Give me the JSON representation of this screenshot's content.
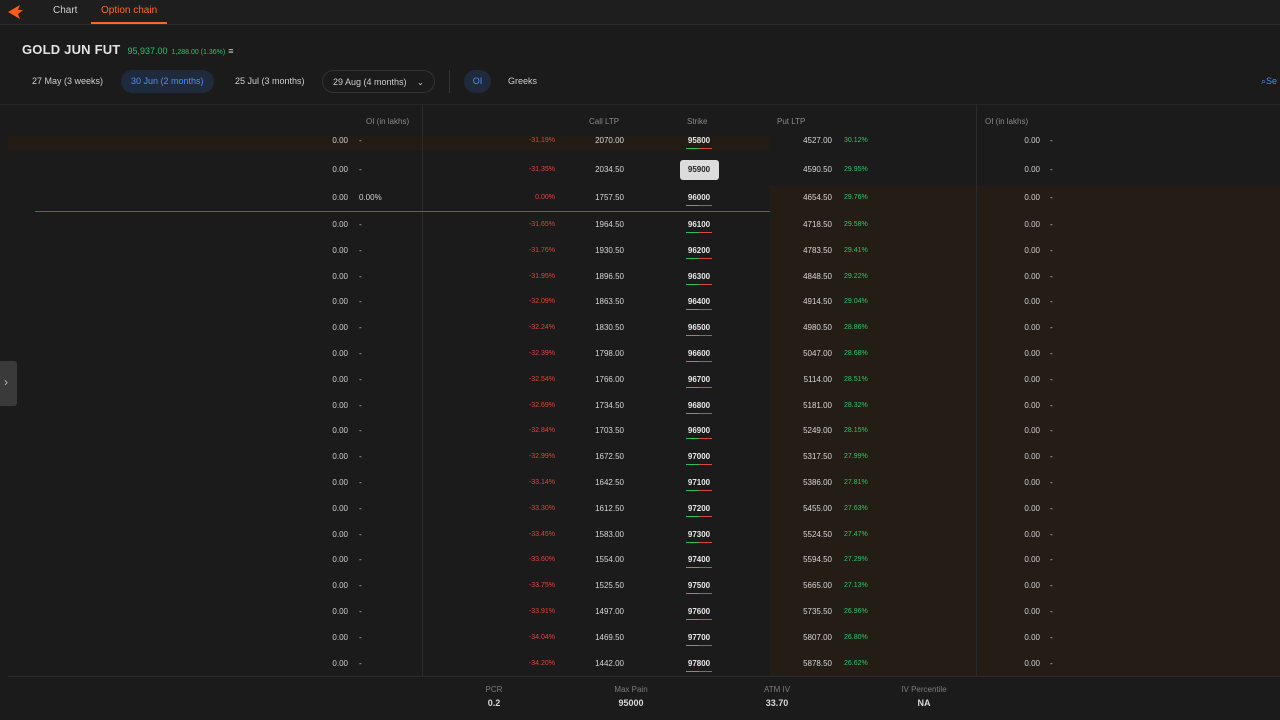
{
  "tabs": [
    {
      "label": "Chart"
    },
    {
      "label": "Option chain"
    }
  ],
  "instrument": {
    "name": "GOLD JUN FUT",
    "price": "95,937.00",
    "change": "1,288.00 (1.36%)",
    "menu_icon": "≡"
  },
  "expiries": [
    {
      "label": "27 May (3 weeks)"
    },
    {
      "label": "30 Jun (2 months)"
    },
    {
      "label": "25 Jul (3 months)"
    },
    {
      "label": "29 Aug (4 months)"
    }
  ],
  "chips": {
    "oi": "OI",
    "greeks": "Greeks"
  },
  "search": {
    "label": "Se"
  },
  "columns": {
    "call_oi": "OI (in lakhs)",
    "call_ltp": "Call LTP",
    "strike": "Strike",
    "put_ltp": "Put LTP",
    "put_oi": "OI (in lakhs)"
  },
  "rows": [
    {
      "call_oi": "0.00",
      "call_oi_ch": "-",
      "call_ch": "-31.19%",
      "call_ltp": "2070.00",
      "strike": "95800",
      "put_ltp": "4527.00",
      "put_ch": "30.12%",
      "put_oi": "0.00",
      "put_oi_ch": "-"
    },
    {
      "call_oi": "0.00",
      "call_oi_ch": "-",
      "call_ch": "-31.35%",
      "call_ltp": "2034.50",
      "strike": "95900",
      "put_ltp": "4590.50",
      "put_ch": "29.95%",
      "put_oi": "0.00",
      "put_oi_ch": "-"
    },
    {
      "call_oi": "0.00",
      "call_oi_ch": "0.00%",
      "call_ch": "0.00%",
      "call_ltp": "1757.50",
      "strike": "96000",
      "put_ltp": "4654.50",
      "put_ch": "29.76%",
      "put_oi": "0.00",
      "put_oi_ch": "-"
    },
    {
      "call_oi": "0.00",
      "call_oi_ch": "-",
      "call_ch": "-31.65%",
      "call_ltp": "1964.50",
      "strike": "96100",
      "put_ltp": "4718.50",
      "put_ch": "29.58%",
      "put_oi": "0.00",
      "put_oi_ch": "-"
    },
    {
      "call_oi": "0.00",
      "call_oi_ch": "-",
      "call_ch": "-31.76%",
      "call_ltp": "1930.50",
      "strike": "96200",
      "put_ltp": "4783.50",
      "put_ch": "29.41%",
      "put_oi": "0.00",
      "put_oi_ch": "-"
    },
    {
      "call_oi": "0.00",
      "call_oi_ch": "-",
      "call_ch": "-31.95%",
      "call_ltp": "1896.50",
      "strike": "96300",
      "put_ltp": "4848.50",
      "put_ch": "29.22%",
      "put_oi": "0.00",
      "put_oi_ch": "-"
    },
    {
      "call_oi": "0.00",
      "call_oi_ch": "-",
      "call_ch": "-32.09%",
      "call_ltp": "1863.50",
      "strike": "96400",
      "put_ltp": "4914.50",
      "put_ch": "29.04%",
      "put_oi": "0.00",
      "put_oi_ch": "-"
    },
    {
      "call_oi": "0.00",
      "call_oi_ch": "-",
      "call_ch": "-32.24%",
      "call_ltp": "1830.50",
      "strike": "96500",
      "put_ltp": "4980.50",
      "put_ch": "28.86%",
      "put_oi": "0.00",
      "put_oi_ch": "-"
    },
    {
      "call_oi": "0.00",
      "call_oi_ch": "-",
      "call_ch": "-32.39%",
      "call_ltp": "1798.00",
      "strike": "96600",
      "put_ltp": "5047.00",
      "put_ch": "28.68%",
      "put_oi": "0.00",
      "put_oi_ch": "-"
    },
    {
      "call_oi": "0.00",
      "call_oi_ch": "-",
      "call_ch": "-32.54%",
      "call_ltp": "1766.00",
      "strike": "96700",
      "put_ltp": "5114.00",
      "put_ch": "28.51%",
      "put_oi": "0.00",
      "put_oi_ch": "-"
    },
    {
      "call_oi": "0.00",
      "call_oi_ch": "-",
      "call_ch": "-32.69%",
      "call_ltp": "1734.50",
      "strike": "96800",
      "put_ltp": "5181.00",
      "put_ch": "28.32%",
      "put_oi": "0.00",
      "put_oi_ch": "-"
    },
    {
      "call_oi": "0.00",
      "call_oi_ch": "-",
      "call_ch": "-32.84%",
      "call_ltp": "1703.50",
      "strike": "96900",
      "put_ltp": "5249.00",
      "put_ch": "28.15%",
      "put_oi": "0.00",
      "put_oi_ch": "-"
    },
    {
      "call_oi": "0.00",
      "call_oi_ch": "-",
      "call_ch": "-32.99%",
      "call_ltp": "1672.50",
      "strike": "97000",
      "put_ltp": "5317.50",
      "put_ch": "27.99%",
      "put_oi": "0.00",
      "put_oi_ch": "-"
    },
    {
      "call_oi": "0.00",
      "call_oi_ch": "-",
      "call_ch": "-33.14%",
      "call_ltp": "1642.50",
      "strike": "97100",
      "put_ltp": "5386.00",
      "put_ch": "27.81%",
      "put_oi": "0.00",
      "put_oi_ch": "-"
    },
    {
      "call_oi": "0.00",
      "call_oi_ch": "-",
      "call_ch": "-33.30%",
      "call_ltp": "1612.50",
      "strike": "97200",
      "put_ltp": "5455.00",
      "put_ch": "27.63%",
      "put_oi": "0.00",
      "put_oi_ch": "-"
    },
    {
      "call_oi": "0.00",
      "call_oi_ch": "-",
      "call_ch": "-33.45%",
      "call_ltp": "1583.00",
      "strike": "97300",
      "put_ltp": "5524.50",
      "put_ch": "27.47%",
      "put_oi": "0.00",
      "put_oi_ch": "-"
    },
    {
      "call_oi": "0.00",
      "call_oi_ch": "-",
      "call_ch": "-33.60%",
      "call_ltp": "1554.00",
      "strike": "97400",
      "put_ltp": "5594.50",
      "put_ch": "27.29%",
      "put_oi": "0.00",
      "put_oi_ch": "-"
    },
    {
      "call_oi": "0.00",
      "call_oi_ch": "-",
      "call_ch": "-33.75%",
      "call_ltp": "1525.50",
      "strike": "97500",
      "put_ltp": "5665.00",
      "put_ch": "27.13%",
      "put_oi": "0.00",
      "put_oi_ch": "-"
    },
    {
      "call_oi": "0.00",
      "call_oi_ch": "-",
      "call_ch": "-33.91%",
      "call_ltp": "1497.00",
      "strike": "97600",
      "put_ltp": "5735.50",
      "put_ch": "26.96%",
      "put_oi": "0.00",
      "put_oi_ch": "-"
    },
    {
      "call_oi": "0.00",
      "call_oi_ch": "-",
      "call_ch": "-34.04%",
      "call_ltp": "1469.50",
      "strike": "97700",
      "put_ltp": "5807.00",
      "put_ch": "26.80%",
      "put_oi": "0.00",
      "put_oi_ch": "-"
    },
    {
      "call_oi": "0.00",
      "call_oi_ch": "-",
      "call_ch": "-34.20%",
      "call_ltp": "1442.00",
      "strike": "97800",
      "put_ltp": "5878.50",
      "put_ch": "26.62%",
      "put_oi": "0.00",
      "put_oi_ch": "-"
    }
  ],
  "stats": [
    {
      "label": "PCR",
      "value": "0.2"
    },
    {
      "label": "Max Pain",
      "value": "95000"
    },
    {
      "label": "ATM IV",
      "value": "33.70"
    },
    {
      "label": "IV Percentile",
      "value": "NA"
    }
  ],
  "colors": {
    "accent": "#ff6a2b",
    "active_blue": "#4f8ff0",
    "positive": "#33c26a",
    "negative": "#e0443c"
  }
}
